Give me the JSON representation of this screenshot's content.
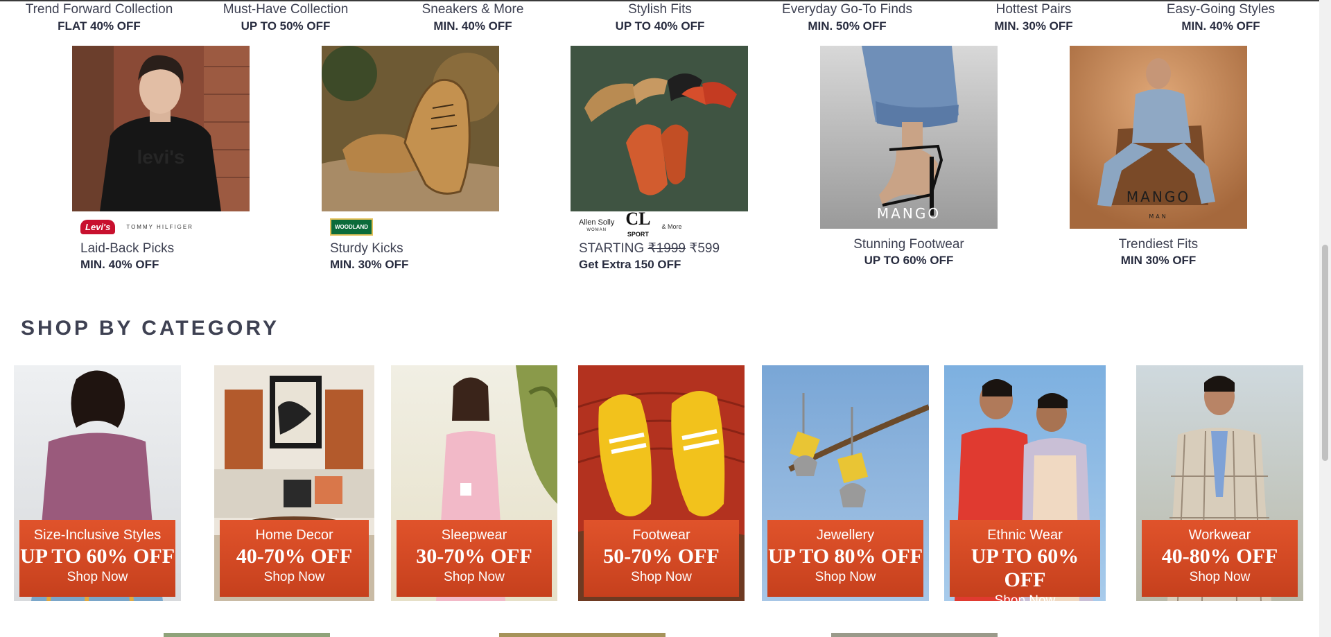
{
  "top_collections": [
    {
      "title": "Trend Forward Collection",
      "offer": "FLAT 40% OFF"
    },
    {
      "title": "Must-Have Collection",
      "offer": "UP TO 50% OFF"
    },
    {
      "title": "Sneakers & More",
      "offer": "MIN. 40% OFF"
    },
    {
      "title": "Stylish Fits",
      "offer": "UP TO 40% OFF"
    },
    {
      "title": "Everyday Go-To Finds",
      "offer": "MIN. 50% OFF"
    },
    {
      "title": "Hottest Pairs",
      "offer": "MIN. 30% OFF"
    },
    {
      "title": "Easy-Going Styles",
      "offer": "MIN. 40% OFF"
    }
  ],
  "brand_cards": [
    {
      "title": "Laid-Back Picks",
      "offer": "MIN. 40% OFF",
      "logos": [
        "Levi's",
        "TOMMY HILFIGER"
      ]
    },
    {
      "title": "Sturdy Kicks",
      "offer": "MIN. 30% OFF",
      "logos": [
        "WOODLAND"
      ]
    },
    {
      "title_prefix": "STARTING",
      "price_old": "₹1999",
      "price_new": "₹599",
      "offer": "Get Extra 150 OFF",
      "logos": [
        "Allen Solly",
        "WOMAN",
        "CL",
        "SPORT",
        "& More"
      ]
    },
    {
      "title": "Stunning Footwear",
      "offer": "UP TO 60% OFF",
      "brand_mark": "MANGO"
    },
    {
      "title": "Trendiest Fits",
      "offer": "MIN 30% OFF",
      "brand_mark": "MANGO",
      "brand_sub": "MAN"
    }
  ],
  "section": {
    "title": "SHOP BY CATEGORY"
  },
  "categories": [
    {
      "title": "Size-Inclusive Styles",
      "offer": "UP TO 60% OFF",
      "cta": "Shop Now"
    },
    {
      "title": "Home Decor",
      "offer": "40-70% OFF",
      "cta": "Shop Now"
    },
    {
      "title": "Sleepwear",
      "offer": "30-70% OFF",
      "cta": "Shop Now"
    },
    {
      "title": "Footwear",
      "offer": "50-70% OFF",
      "cta": "Shop Now"
    },
    {
      "title": "Jewellery",
      "offer": "UP TO 80% OFF",
      "cta": "Shop Now"
    },
    {
      "title": "Ethnic Wear",
      "offer": "UP TO 60% OFF",
      "cta": "Shop Now"
    },
    {
      "title": "Workwear",
      "offer": "40-80% OFF",
      "cta": "Shop Now"
    }
  ],
  "colors": {
    "banner": "#d24a24",
    "text_dark": "#282c3f",
    "heading": "#3e4152"
  }
}
